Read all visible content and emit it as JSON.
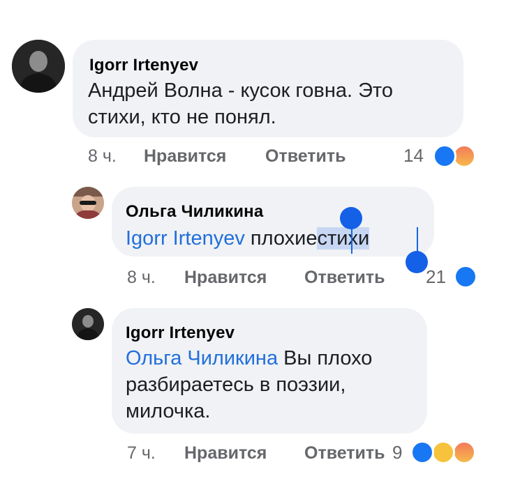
{
  "comments": [
    {
      "author": "Igorr Irtenyev",
      "text_lines": [
        "Андрей Волна - кусок говна. Это",
        "стихи, кто не понял."
      ],
      "time": "8 ч.",
      "like_label": "Нравится",
      "reply_label": "Ответить",
      "reaction_count": "14",
      "reactions": [
        "like",
        "angry"
      ]
    },
    {
      "author": "Ольга Чиликина",
      "mention": "Igorr Irtenyev",
      "text_before": " плохие",
      "text_selected": "стихи",
      "time": "8 ч.",
      "like_label": "Нравится",
      "reply_label": "Ответить",
      "reaction_count": "21",
      "reactions": [
        "like"
      ]
    },
    {
      "author": "Igorr Irtenyev",
      "mention": "Ольга Чиликина",
      "text_first": " Вы плохо",
      "text_lines": [
        "разбираетесь в поэзии,",
        "милочка."
      ],
      "time": "7 ч.",
      "like_label": "Нравится",
      "reply_label": "Ответить",
      "reaction_count": "9",
      "reactions": [
        "like",
        "haha",
        "angry"
      ]
    }
  ],
  "colors": {
    "bubble": "#f0f2f5",
    "mention": "#216fdb",
    "meta": "#65676b",
    "like": "#1877f2",
    "selection": "#c7d7f3",
    "selection_handle": "#1460e6"
  }
}
